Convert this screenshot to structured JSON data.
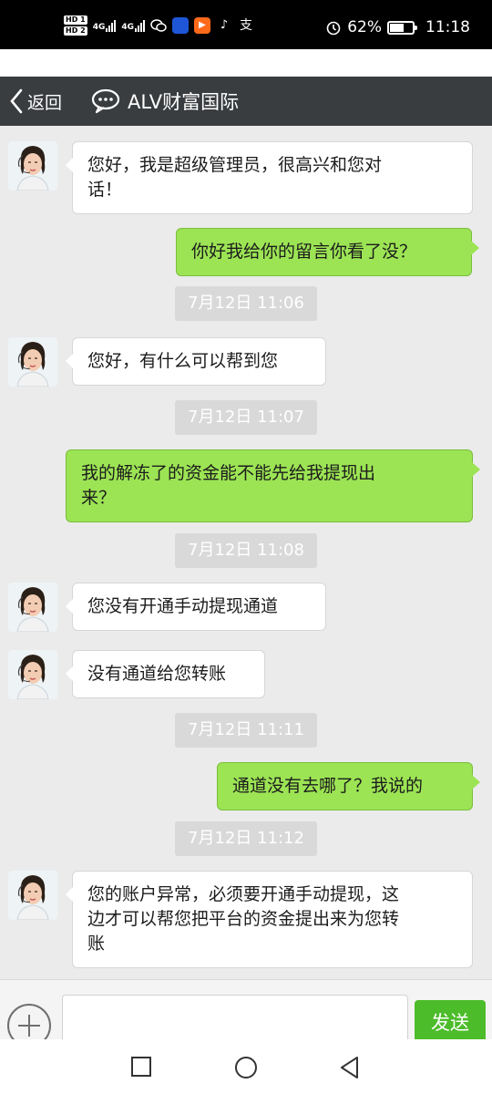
{
  "status_bar": {
    "hd1": "HD 1",
    "hd2": "HD 2",
    "net1": "4G",
    "net2": "4G",
    "battery_percent": "62%",
    "battery_level": 0.62,
    "time": "11:18",
    "icons": [
      "wechat-icon",
      "app-icon",
      "video-app-icon",
      "tiktok-icon",
      "alipay-icon",
      "alarm-icon"
    ]
  },
  "header": {
    "back_label": "返回",
    "title": "ALV财富国际"
  },
  "messages": [
    {
      "type": "in",
      "lines": [
        "您好，我是超级管理员，很高兴和您对",
        "话！"
      ]
    },
    {
      "type": "out",
      "lines": [
        "你好我给你的留言你看了没？"
      ]
    },
    {
      "type": "time",
      "text": "7月12日 11:06"
    },
    {
      "type": "in",
      "lines": [
        "您好，有什么可以帮到您"
      ]
    },
    {
      "type": "time",
      "text": "7月12日 11:07"
    },
    {
      "type": "out",
      "lines": [
        "我的解冻了的资金能不能先给我提现出",
        "来？"
      ]
    },
    {
      "type": "time",
      "text": "7月12日 11:08"
    },
    {
      "type": "in",
      "lines": [
        "您没有开通手动提现通道"
      ]
    },
    {
      "type": "in",
      "lines": [
        "没有通道给您转账"
      ]
    },
    {
      "type": "time",
      "text": "7月12日 11:11"
    },
    {
      "type": "out",
      "lines": [
        "通道没有去哪了？我说的"
      ]
    },
    {
      "type": "time",
      "text": "7月12日 11:12"
    },
    {
      "type": "in",
      "lines": [
        "您的账户异常，必须要开通手动提现，这",
        "边才可以帮您把平台的资金提出来为您转",
        "账"
      ]
    }
  ],
  "input": {
    "value": "",
    "send_label": "发送"
  },
  "colors": {
    "header_bg": "#3a3d40",
    "outgoing_bubble": "#9ce454",
    "send_button": "#4cbc2a"
  }
}
